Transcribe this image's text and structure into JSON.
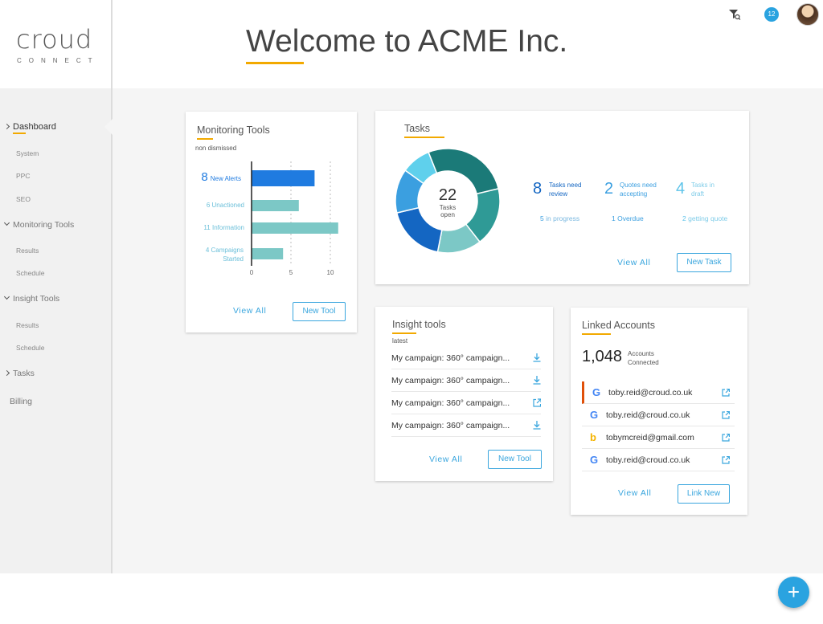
{
  "brand": {
    "logo_word": "croud",
    "logo_sub": "CONNECT"
  },
  "header": {
    "title": "Welcome to ACME Inc.",
    "notifications": "12",
    "filter_icon": "filter-search-icon",
    "accent": "#f2a900"
  },
  "sidebar": {
    "items": [
      {
        "label": "Dashboard"
      },
      {
        "label": "System"
      },
      {
        "label": "PPC"
      },
      {
        "label": "SEO"
      },
      {
        "label": "Monitoring Tools"
      },
      {
        "label": "Results"
      },
      {
        "label": "Schedule"
      },
      {
        "label": "Insight Tools"
      },
      {
        "label": "Results"
      },
      {
        "label": "Schedule"
      },
      {
        "label": "Tasks"
      },
      {
        "label": "Billing"
      }
    ]
  },
  "monitoring": {
    "title": "Monitoring Tools",
    "subtitle": "non dismissed",
    "view_all": "View All",
    "new_tool": "New Tool",
    "rows": [
      {
        "num": "8",
        "label": "New Alerts"
      },
      {
        "num": "6",
        "label": "Unactioned"
      },
      {
        "num": "11",
        "label": "Information"
      },
      {
        "num": "4",
        "label": "Campaigns Started"
      }
    ]
  },
  "tasks": {
    "title": "Tasks",
    "center_num": "22",
    "center_label": "Tasks open",
    "stats": [
      {
        "num": "8",
        "label": "Tasks need review",
        "sub_num": "5",
        "sub": "in progress"
      },
      {
        "num": "2",
        "label": "Quotes need accepting",
        "sub_num": "1",
        "sub": "Overdue"
      },
      {
        "num": "4",
        "label": "Tasks in draft",
        "sub_num": "2",
        "sub": "getting quote"
      }
    ],
    "view_all": "View All",
    "new_task": "New Task"
  },
  "insight": {
    "title": "Insight tools",
    "subtitle": "latest",
    "rows": [
      {
        "label": "My campaign: 360° campaign...",
        "icon": "download-icon"
      },
      {
        "label": "My campaign: 360° campaign...",
        "icon": "download-icon"
      },
      {
        "label": "My campaign: 360° campaign...",
        "icon": "external-link-icon"
      },
      {
        "label": "My campaign: 360° campaign...",
        "icon": "download-icon"
      }
    ],
    "view_all": "View All",
    "new_tool": "New Tool"
  },
  "linked": {
    "title": "Linked Accounts",
    "count": "1,048",
    "count_label": "Accounts Connected",
    "rows": [
      {
        "logo": "G",
        "email": "toby.reid@croud.co.uk",
        "provider": "google"
      },
      {
        "logo": "G",
        "email": "toby.reid@croud.co.uk",
        "provider": "google"
      },
      {
        "logo": "b",
        "email": "tobymcreid@gmail.com",
        "provider": "bing"
      },
      {
        "logo": "G",
        "email": "toby.reid@croud.co.uk",
        "provider": "google"
      }
    ],
    "view_all": "View All",
    "link_new": "Link New"
  },
  "fab": {
    "label": "+"
  },
  "chart_data": [
    {
      "type": "bar",
      "orientation": "horizontal",
      "categories": [
        "New Alerts",
        "Unactioned",
        "Information",
        "Campaigns Started"
      ],
      "values": [
        8,
        6,
        11,
        4
      ],
      "xticks": [
        "0",
        "5",
        "10"
      ],
      "xlim": [
        0,
        12
      ],
      "colors": [
        "#1f7be0",
        "#7cc8c6",
        "#7cc8c6",
        "#7cc8c6"
      ],
      "grid": "dashed vertical"
    },
    {
      "type": "pie",
      "donut": true,
      "values": [
        6,
        4,
        3,
        4,
        3,
        2
      ],
      "colors": [
        "#1b7a78",
        "#2f9a96",
        "#7cc8c6",
        "#1466c2",
        "#3b9fe0",
        "#5fd0ec"
      ]
    }
  ]
}
